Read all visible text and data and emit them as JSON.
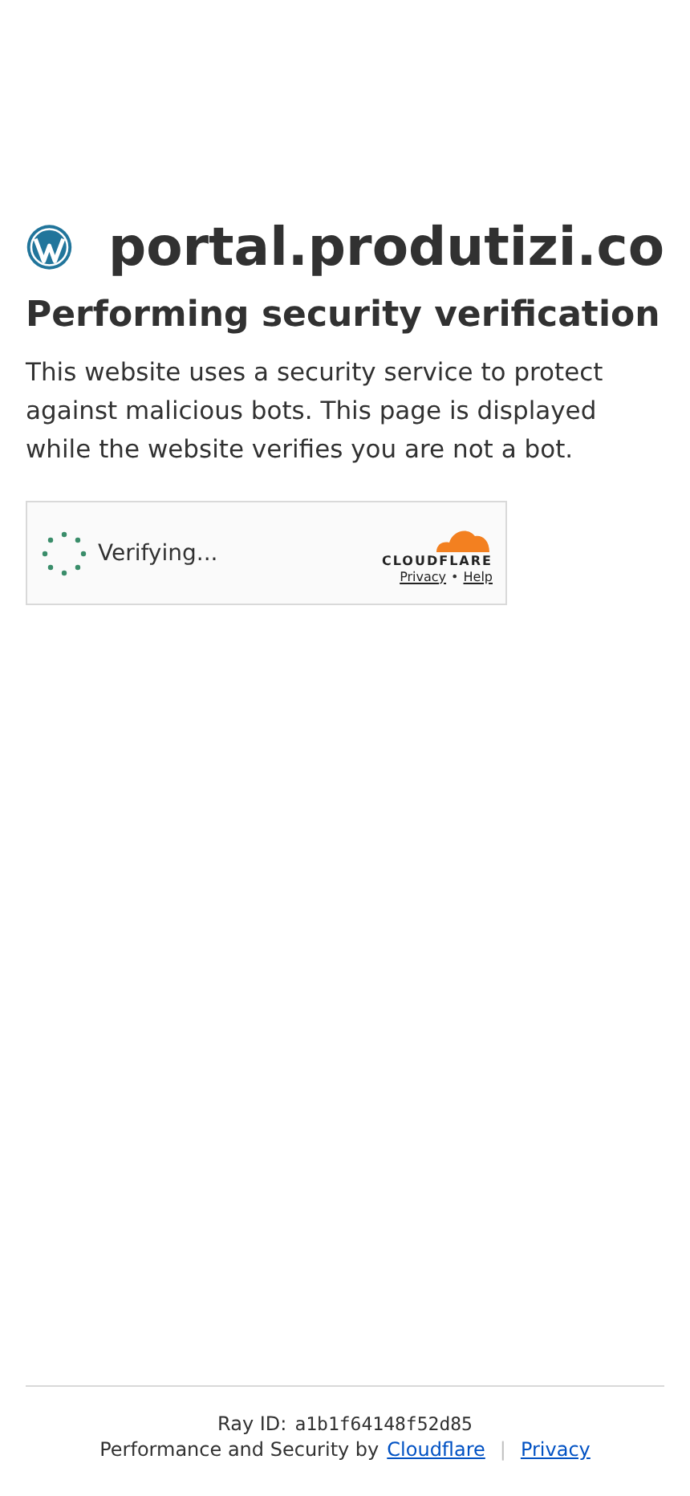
{
  "header": {
    "site": "portal.produtizi.co"
  },
  "title": "Performing security verification",
  "description": "This website uses a security service to protect against malicious bots. This page is displayed while the website verifies you are not a bot.",
  "widget": {
    "status": "Verifying...",
    "brand": "CLOUDFLARE",
    "links": [
      "Privacy",
      "Help"
    ],
    "separator": "•"
  },
  "footer": {
    "ray_label": "Ray ID:",
    "ray_id": "a1b1f64148f52d85",
    "credit": "Performance and Security by",
    "links": [
      "Cloudflare",
      "Privacy"
    ],
    "separator": "|"
  }
}
